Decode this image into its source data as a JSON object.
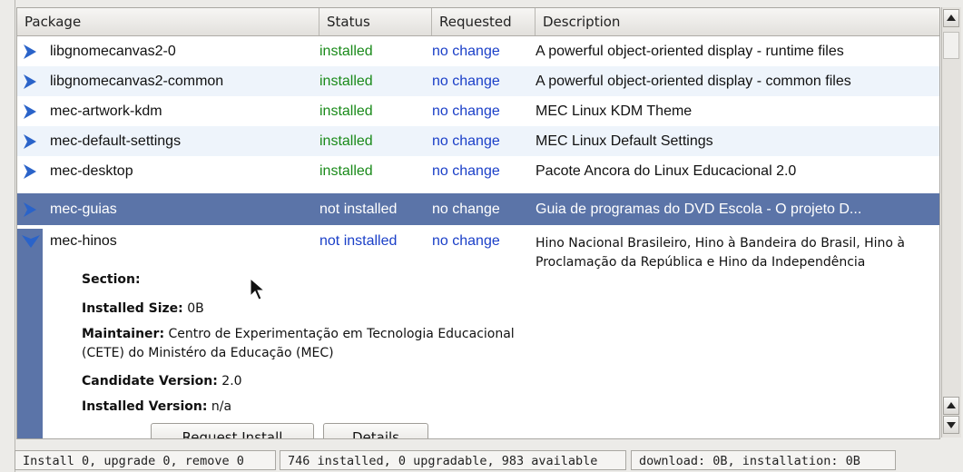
{
  "table": {
    "headers": {
      "package": "Package",
      "status": "Status",
      "requested": "Requested",
      "description": "Description"
    },
    "rows": [
      {
        "name": "libgnomecanvas2-0",
        "status": "installed",
        "requested": "no change",
        "description": "A powerful object-oriented display - runtime files"
      },
      {
        "name": "libgnomecanvas2-common",
        "status": "installed",
        "requested": "no change",
        "description": "A powerful object-oriented display - common files"
      },
      {
        "name": "mec-artwork-kdm",
        "status": "installed",
        "requested": "no change",
        "description": "MEC Linux KDM Theme"
      },
      {
        "name": "mec-default-settings",
        "status": "installed",
        "requested": "no change",
        "description": "MEC Linux Default Settings"
      },
      {
        "name": "mec-desktop",
        "status": "installed",
        "requested": "no change",
        "description": "Pacote Ancora do Linux Educacional 2.0"
      },
      {
        "name": "mec-guias",
        "status": "not installed",
        "requested": "no change",
        "description": "Guia de programas do DVD Escola - O projeto D..."
      }
    ],
    "expanded": {
      "name": "mec-hinos",
      "status": "not installed",
      "requested": "no change",
      "description": "Hino Nacional Brasileiro, Hino à Bandeira do Brasil, Hino à Proclamação da República e Hino da Independência",
      "section_label": "Section:",
      "installed_size_label": "Installed Size:",
      "installed_size_value": "0B",
      "maintainer_label": "Maintainer:",
      "maintainer_value": "Centro de Experimentação em Tecnologia Educacional (CETE) do Ministéro da Educação (MEC)",
      "candidate_label": "Candidate Version:",
      "candidate_value": "2.0",
      "installed_version_label": "Installed Version:",
      "installed_version_value": "n/a",
      "request_install_label": "Request Install",
      "details_label": "Details"
    }
  },
  "statusbar": {
    "changes": "Install 0, upgrade 0, remove 0",
    "counts": "746 installed, 0 upgradable, 983 available",
    "download": "download: 0B, installation: 0B"
  },
  "colors": {
    "selection": "#5b74a8",
    "installed": "#1a8a1a",
    "request": "#1a3fc8",
    "arrow": "#2a63c9"
  },
  "icons": {
    "collapsed": "chevron-right-icon",
    "expanded": "chevron-down-icon"
  }
}
